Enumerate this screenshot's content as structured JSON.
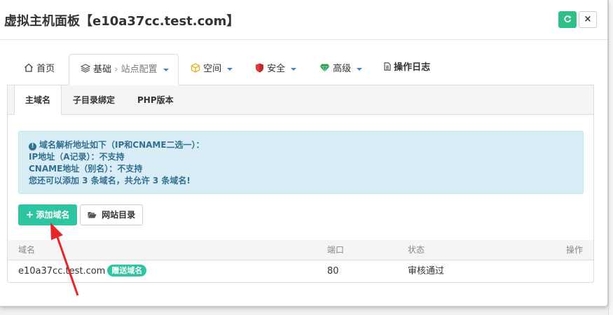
{
  "dialog": {
    "title": "虚拟主机面板【e10a37cc.test.com】",
    "refresh_icon": "refresh-icon",
    "close_label": "×"
  },
  "nav": {
    "home": "首页",
    "basic": "基础",
    "separator": "›",
    "site_config": "站点配置",
    "space": "空间",
    "security": "安全",
    "advanced": "高级",
    "logs": "操作日志"
  },
  "subtabs": [
    "主域名",
    "子目录绑定",
    "PHP版本"
  ],
  "alert": {
    "line1": "域名解析地址如下（IP和CNAME二选一）：",
    "line2": "IP地址（A记录）：不支持",
    "line3": "CNAME地址（别名）：不支持",
    "line4": "您还可以添加 3 条域名，共允许 3 条域名!"
  },
  "buttons": {
    "add_domain": "添加域名",
    "site_dir": "网站目录"
  },
  "table": {
    "headers": {
      "domain": "域名",
      "port": "端口",
      "status": "状态",
      "actions": "操作"
    },
    "rows": [
      {
        "domain": "e10a37cc.test.com",
        "badge": "赠送域名",
        "port": "80",
        "status": "审核通过"
      }
    ]
  },
  "colors": {
    "accent_green": "#2fc4a1",
    "refresh_green": "#2ec086",
    "alert_bg": "#d9edf7",
    "alert_text": "#31708f",
    "annotation_red": "#e8262a"
  }
}
